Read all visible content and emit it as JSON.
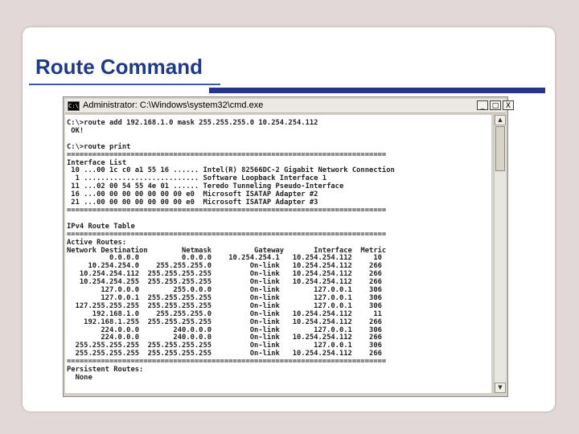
{
  "slide": {
    "title": "Route Command"
  },
  "window": {
    "title": "Administrator: C:\\Windows\\system32\\cmd.exe",
    "icon_text": "C:\\",
    "controls": {
      "minimize": "_",
      "maximize": "□",
      "close": "X"
    }
  },
  "console": {
    "text": "C:\\>route add 192.168.1.0 mask 255.255.255.0 10.254.254.112\n OK!\n\nC:\\>route print\n===========================================================================\nInterface List\n 10 ...00 1c c0 a1 55 16 ...... Intel(R) 82566DC-2 Gigabit Network Connection\n  1 ........................... Software Loopback Interface 1\n 11 ...02 00 54 55 4e 01 ...... Teredo Tunneling Pseudo-Interface\n 16 ...00 00 00 00 00 00 00 e0  Microsoft ISATAP Adapter #2\n 21 ...00 00 00 00 00 00 00 e0  Microsoft ISATAP Adapter #3\n===========================================================================\n\nIPv4 Route Table\n===========================================================================\nActive Routes:\nNetwork Destination        Netmask          Gateway       Interface  Metric\n          0.0.0.0          0.0.0.0    10.254.254.1   10.254.254.112     10\n     10.254.254.0    255.255.255.0         On-link   10.254.254.112    266\n   10.254.254.112  255.255.255.255         On-link   10.254.254.112    266\n   10.254.254.255  255.255.255.255         On-link   10.254.254.112    266\n        127.0.0.0        255.0.0.0         On-link        127.0.0.1    306\n        127.0.0.1  255.255.255.255         On-link        127.0.0.1    306\n  127.255.255.255  255.255.255.255         On-link        127.0.0.1    306\n      192.168.1.0    255.255.255.0         On-link   10.254.254.112     11\n    192.168.1.255  255.255.255.255         On-link   10.254.254.112    266\n        224.0.0.0        240.0.0.0         On-link        127.0.0.1    306\n        224.0.0.0        240.0.0.0         On-link   10.254.254.112    266\n  255.255.255.255  255.255.255.255         On-link        127.0.0.1    306\n  255.255.255.255  255.255.255.255         On-link   10.254.254.112    266\n===========================================================================\nPersistent Routes:\n  None"
  },
  "scrollbar": {
    "up_arrow": "▲",
    "down_arrow": "▼"
  }
}
